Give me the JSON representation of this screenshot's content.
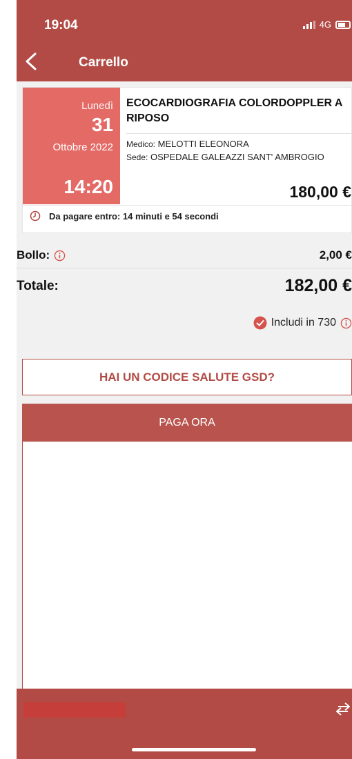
{
  "status_bar": {
    "time": "19:04",
    "network": "4G"
  },
  "nav": {
    "title": "Carrello",
    "back_icon": "chevron-left-icon"
  },
  "appointment": {
    "day_name": "Lunedì",
    "day_number": "31",
    "month_year": "Ottobre 2022",
    "time": "14:20",
    "title": "ECOCARDIOGRAFIA COLORDOPPLER A RIPOSO",
    "doctor_label": "Medico:",
    "doctor_name": "MELOTTI ELEONORA",
    "place_label": "Sede:",
    "place_name": "OSPEDALE GALEAZZI SANT' AMBROGIO",
    "price": "180,00 €",
    "pay_deadline": "Da pagare entro: 14 minuti e 54 secondi"
  },
  "summary": {
    "bollo_label": "Bollo:",
    "bollo_value": "2,00 €",
    "total_label": "Totale:",
    "total_value": "182,00 €",
    "include_730_label": "Includi in 730"
  },
  "buttons": {
    "codice_salute": "HAI UN CODICE SALUTE GSD?",
    "paga_ora": "PAGA ORA"
  },
  "colors": {
    "brand": "#b24b45",
    "date_box": "#e46a66",
    "background": "#f1f1f1"
  }
}
